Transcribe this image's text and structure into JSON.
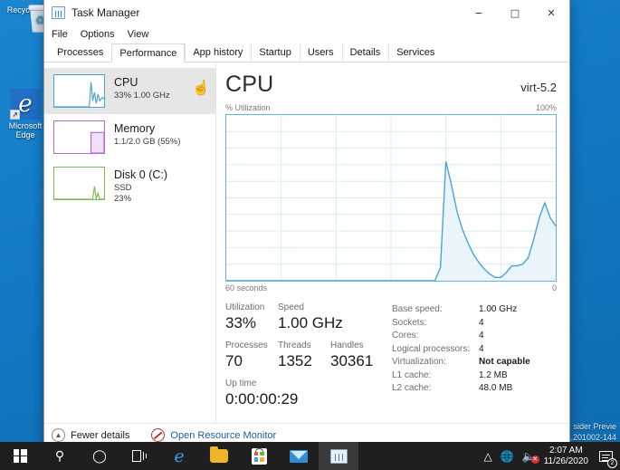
{
  "desktop": {
    "icons": [
      {
        "name": "recycle-bin",
        "label": "Recycle B"
      },
      {
        "name": "microsoft-edge",
        "label": "Microsoft Edge"
      }
    ],
    "watermark_line1": "sider Previe",
    "watermark_line2": ".201002-144"
  },
  "window": {
    "title": "Task Manager",
    "controls": {
      "minimize": "–",
      "maximize": "☐",
      "close": "✕"
    }
  },
  "menu": {
    "items": [
      "File",
      "Options",
      "View"
    ]
  },
  "tabs": {
    "items": [
      "Processes",
      "Performance",
      "App history",
      "Startup",
      "Users",
      "Details",
      "Services"
    ],
    "active": "Performance"
  },
  "sidebar": {
    "items": [
      {
        "name": "cpu",
        "title": "CPU",
        "sub": "33%  1.00 GHz",
        "sub2": "",
        "color": "#4aa5d6",
        "selected": true
      },
      {
        "name": "memory",
        "title": "Memory",
        "sub": "1.1/2.0 GB (55%)",
        "sub2": "",
        "color": "#b968cf",
        "selected": false
      },
      {
        "name": "disk",
        "title": "Disk 0 (C:)",
        "sub": "SSD",
        "sub2": "23%",
        "color": "#7cbb52",
        "selected": false
      }
    ]
  },
  "main": {
    "heading": "CPU",
    "model": "virt-5.2",
    "axis_top_left": "% Utilization",
    "axis_top_right": "100%",
    "axis_bottom_left": "60 seconds",
    "axis_bottom_right": "0",
    "stats": {
      "row1": [
        {
          "label": "Utilization",
          "value": "33%"
        },
        {
          "label": "Speed",
          "value": "1.00 GHz"
        }
      ],
      "row2": [
        {
          "label": "Processes",
          "value": "70"
        },
        {
          "label": "Threads",
          "value": "1352"
        },
        {
          "label": "Handles",
          "value": "30361"
        }
      ],
      "row3": [
        {
          "label": "Up time",
          "value": "0:00:00:29"
        }
      ]
    },
    "specs": [
      {
        "key": "Base speed:",
        "value": "1.00 GHz",
        "bold": false
      },
      {
        "key": "Sockets:",
        "value": "4",
        "bold": false
      },
      {
        "key": "Cores:",
        "value": "4",
        "bold": false
      },
      {
        "key": "Logical processors:",
        "value": "4",
        "bold": false
      },
      {
        "key": "Virtualization:",
        "value": "Not capable",
        "bold": true
      },
      {
        "key": "L1 cache:",
        "value": "1.2 MB",
        "bold": false
      },
      {
        "key": "L2 cache:",
        "value": "48.0 MB",
        "bold": false
      }
    ]
  },
  "status": {
    "fewer_details": "Fewer details",
    "resource_monitor": "Open Resource Monitor"
  },
  "taskbar": {
    "clock_time": "2:07 AM",
    "clock_date": "11/26/2020",
    "notification_count": "2",
    "items": [
      "search",
      "cortana",
      "task-view",
      "edge",
      "file-explorer",
      "microsoft-store",
      "mail",
      "task-manager"
    ]
  },
  "chart_data": {
    "type": "area",
    "title": "CPU % Utilization",
    "xlabel": "60 seconds",
    "ylabel": "% Utilization",
    "ylim": [
      0,
      100
    ],
    "xlim": [
      0,
      60
    ],
    "grid": true,
    "legend": null,
    "line_color": "#4aa5d6",
    "fill_color": "#eaf4fb",
    "x": [
      0,
      36,
      38,
      39,
      40,
      41,
      42,
      43,
      44,
      45,
      46,
      47,
      48,
      49,
      50,
      51,
      52,
      53,
      54,
      55,
      56,
      57,
      58,
      59,
      60
    ],
    "values": [
      0,
      0,
      0,
      8,
      72,
      58,
      42,
      31,
      23,
      16,
      11,
      7,
      4,
      2,
      2,
      5,
      9,
      9,
      10,
      14,
      25,
      38,
      47,
      38,
      33
    ]
  }
}
